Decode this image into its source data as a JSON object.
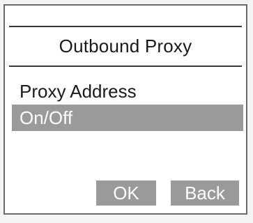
{
  "screen": {
    "title": "Outbound Proxy"
  },
  "menu": {
    "items": [
      {
        "label": "Proxy Address",
        "selected": false
      },
      {
        "label": "On/Off",
        "selected": true
      }
    ]
  },
  "softkeys": {
    "ok_label": "OK",
    "back_label": "Back"
  },
  "colors": {
    "highlight": "#9a9a9a",
    "border": "#3a3a3a",
    "background": "#ffffff"
  }
}
